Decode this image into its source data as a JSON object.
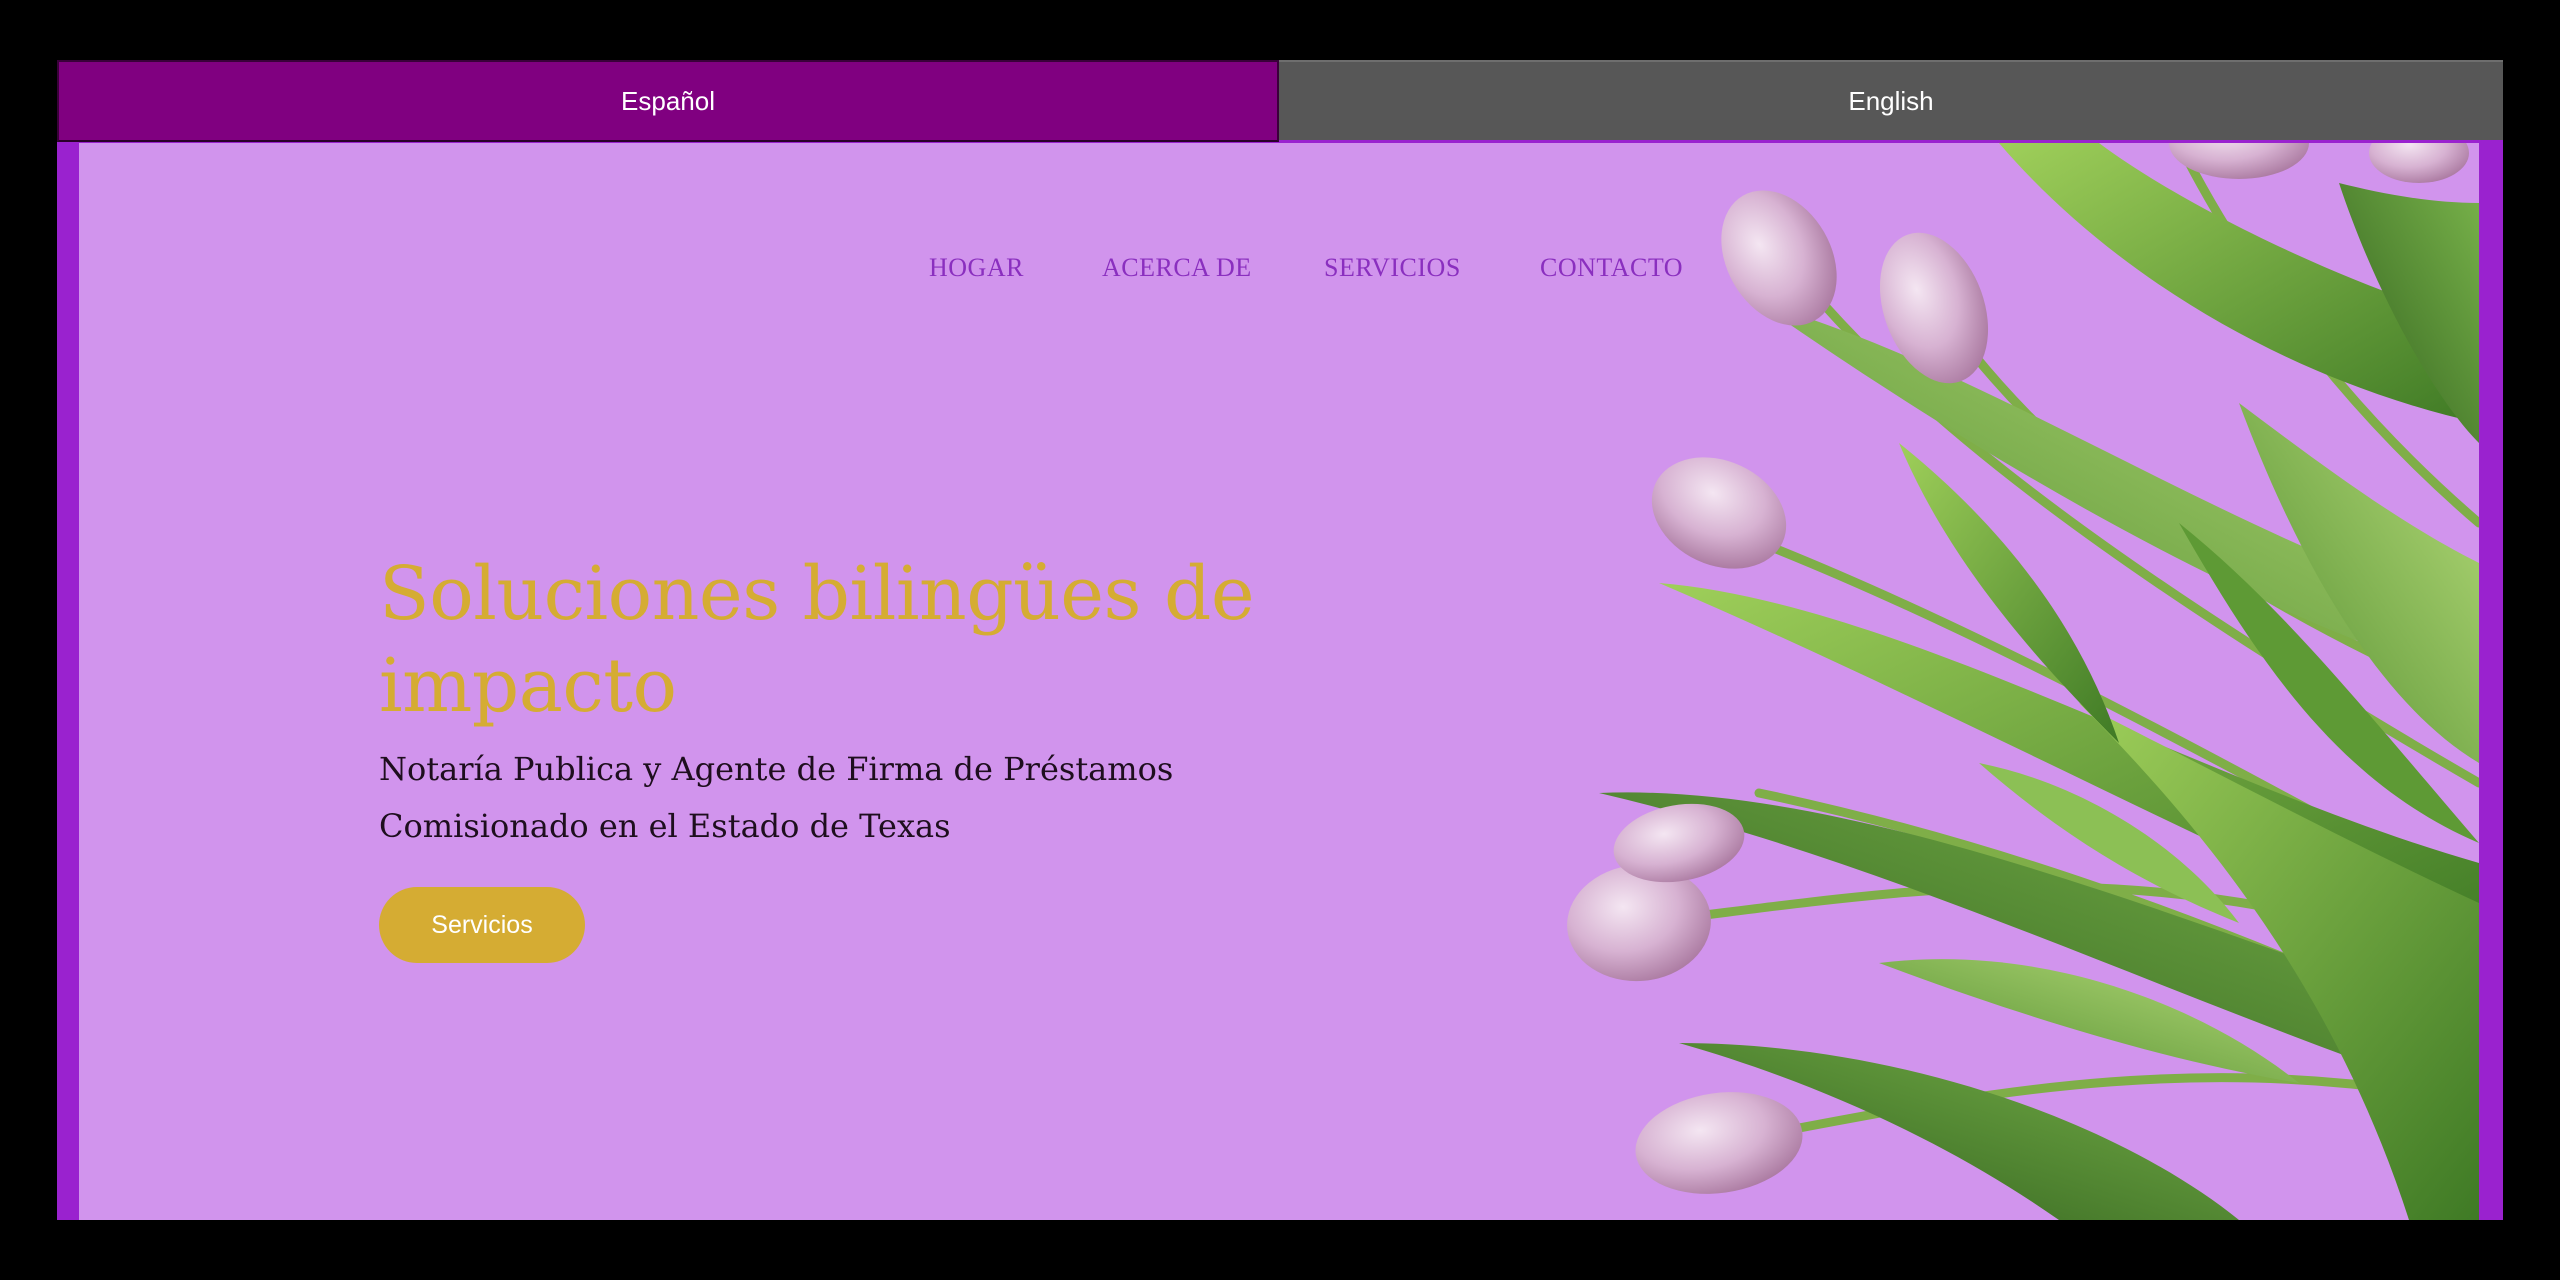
{
  "language_tabs": {
    "spanish_label": "Español",
    "english_label": "English"
  },
  "nav": {
    "items": [
      {
        "label": "HOGAR"
      },
      {
        "label": "ACERCA DE"
      },
      {
        "label": "SERVICIOS"
      },
      {
        "label": "CONTACTO"
      }
    ]
  },
  "hero": {
    "headline": "Soluciones bilingües de impacto",
    "subline": "Notaría Publica y Agente de Firma de Préstamos Comisionado en el Estado de Texas",
    "cta_label": "Servicios",
    "image": "tulip-bouquet-illustration"
  },
  "colors": {
    "page_background": "#000000",
    "frame_border": "#9a22cf",
    "hero_background": "#d194ed",
    "spanish_tab": "#800080",
    "english_tab": "#575757",
    "nav_text": "#8a2fbf",
    "headline_gold": "#d5ac33",
    "button_gold": "#d5ac33",
    "body_text": "#1e0e1e"
  }
}
